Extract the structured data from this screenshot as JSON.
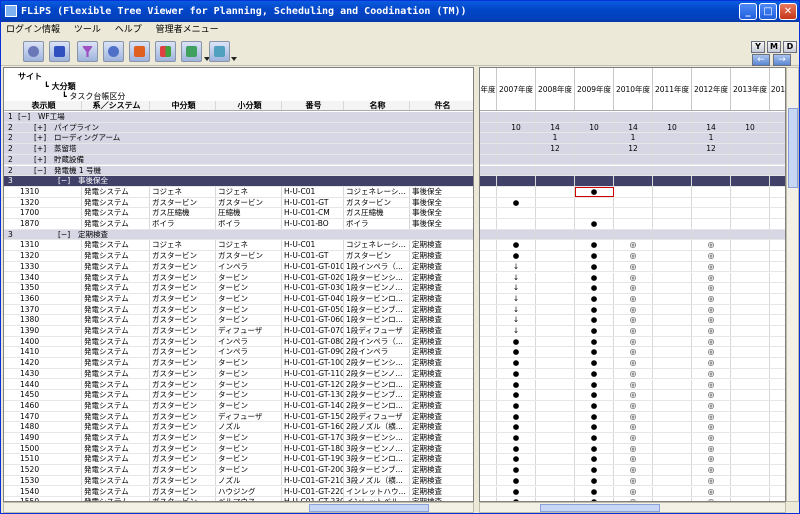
{
  "window": {
    "title": "FLiPS (Flexible Tree Viewer for Planning, Scheduling and Coodination (TM))"
  },
  "menu": [
    "ログイン情報",
    "ツール",
    "ヘルプ",
    "管理者メニュー"
  ],
  "toolbar_icons": [
    "binoculars-icon",
    "grid-blue-icon",
    "filter-icon",
    "search-icon",
    "grid-dots-icon",
    "color-grid-icon",
    "export-icon",
    "settings-icon"
  ],
  "right_buttons": {
    "y": "Y",
    "m": "M",
    "d": "D"
  },
  "tree_header": {
    "site": "サイト",
    "category_large": "大分類",
    "task_ledger": "タスク台帳区分",
    "columns": [
      "表示順",
      "系／システム",
      "中分類",
      "小分類",
      "番号",
      "名称",
      "件名"
    ]
  },
  "years": [
    "年度",
    "2007年度",
    "2008年度",
    "2009年度",
    "2010年度",
    "2011年度",
    "2012年度",
    "2013年度",
    "201"
  ],
  "tree_rows": [
    {
      "type": "g",
      "c": [
        "1",
        "[−]",
        "WF工場"
      ]
    },
    {
      "type": "g",
      "c": [
        "2",
        "[+]",
        "パイプライン"
      ]
    },
    {
      "type": "g",
      "c": [
        "2",
        "[+]",
        "ローディングアーム"
      ]
    },
    {
      "type": "g",
      "c": [
        "2",
        "[+]",
        "蒸留塔"
      ]
    },
    {
      "type": "g",
      "c": [
        "2",
        "[+]",
        "貯蔵設備"
      ]
    },
    {
      "type": "g",
      "c": [
        "2",
        "[−]",
        "発電機 1 号機"
      ]
    },
    {
      "type": "d",
      "c": [
        "3",
        "[−]",
        "事後保全"
      ]
    },
    {
      "type": "r",
      "c": [
        "1310",
        "発電システム",
        "コジェネ",
        "コジェネ",
        "H-U-C01",
        "コジェネレーシ...",
        "事後保全"
      ]
    },
    {
      "type": "r",
      "c": [
        "1320",
        "発電システム",
        "ガスタービン",
        "ガスタービン",
        "H-U-C01-GT",
        "ガスタービン",
        "事後保全"
      ]
    },
    {
      "type": "r",
      "c": [
        "1700",
        "発電システム",
        "ガス圧縮機",
        "圧縮機",
        "H-U-C01-CM",
        "ガス圧縮機",
        "事後保全"
      ]
    },
    {
      "type": "r",
      "c": [
        "1870",
        "発電システム",
        "ボイラ",
        "ボイラ",
        "H-U-C01-BO",
        "ボイラ",
        "事後保全"
      ]
    },
    {
      "type": "s",
      "c": [
        "3",
        "[−]",
        "定期検査"
      ]
    },
    {
      "type": "r",
      "c": [
        "1310",
        "発電システム",
        "コジェネ",
        "コジェネ",
        "H-U-C01",
        "コジェネレーシ...",
        "定期検査"
      ]
    },
    {
      "type": "r",
      "c": [
        "1320",
        "発電システム",
        "ガスタービン",
        "ガスタービン",
        "H-U-C01-GT",
        "ガスタービン",
        "定期検査"
      ]
    },
    {
      "type": "r",
      "c": [
        "1330",
        "発電システム",
        "ガスタービン",
        "インペラ",
        "H-U-C01-GT-010",
        "1段インペラ（...",
        "定期検査"
      ]
    },
    {
      "type": "r",
      "c": [
        "1340",
        "発電システム",
        "ガスタービン",
        "タービン",
        "H-U-C01-GT-020",
        "1段タービンシ...",
        "定期検査"
      ]
    },
    {
      "type": "r",
      "c": [
        "1350",
        "発電システム",
        "ガスタービン",
        "タービン",
        "H-U-C01-GT-030",
        "1段タービンノ...",
        "定期検査"
      ]
    },
    {
      "type": "r",
      "c": [
        "1360",
        "発電システム",
        "ガスタービン",
        "タービン",
        "H-U-C01-GT-040",
        "1段タービンロ...",
        "定期検査"
      ]
    },
    {
      "type": "r",
      "c": [
        "1370",
        "発電システム",
        "ガスタービン",
        "タービン",
        "H-U-C01-GT-050",
        "1段タービンブ...",
        "定期検査"
      ]
    },
    {
      "type": "r",
      "c": [
        "1380",
        "発電システム",
        "ガスタービン",
        "タービン",
        "H-U-C01-GT-060",
        "1段タービンロ...",
        "定期検査"
      ]
    },
    {
      "type": "r",
      "c": [
        "1390",
        "発電システム",
        "ガスタービン",
        "ディフューザ",
        "H-U-C01-GT-070",
        "1段ディフューザ",
        "定期検査"
      ]
    },
    {
      "type": "r",
      "c": [
        "1400",
        "発電システム",
        "ガスタービン",
        "インペラ",
        "H-U-C01-GT-080",
        "2段インペラ（...",
        "定期検査"
      ]
    },
    {
      "type": "r",
      "c": [
        "1410",
        "発電システム",
        "ガスタービン",
        "インペラ",
        "H-U-C01-GT-090",
        "2段インペラ",
        "定期検査"
      ]
    },
    {
      "type": "r",
      "c": [
        "1420",
        "発電システム",
        "ガスタービン",
        "タービン",
        "H-U-C01-GT-100",
        "2段タービンシ...",
        "定期検査"
      ]
    },
    {
      "type": "r",
      "c": [
        "1430",
        "発電システム",
        "ガスタービン",
        "タービン",
        "H-U-C01-GT-110",
        "2段タービンノ...",
        "定期検査"
      ]
    },
    {
      "type": "r",
      "c": [
        "1440",
        "発電システム",
        "ガスタービン",
        "タービン",
        "H-U-C01-GT-120",
        "2段タービンロ...",
        "定期検査"
      ]
    },
    {
      "type": "r",
      "c": [
        "1450",
        "発電システム",
        "ガスタービン",
        "タービン",
        "H-U-C01-GT-130",
        "2段タービンブ...",
        "定期検査"
      ]
    },
    {
      "type": "r",
      "c": [
        "1460",
        "発電システム",
        "ガスタービン",
        "タービン",
        "H-U-C01-GT-140",
        "2段タービンロ...",
        "定期検査"
      ]
    },
    {
      "type": "r",
      "c": [
        "1470",
        "発電システム",
        "ガスタービン",
        "ディフューザ",
        "H-U-C01-GT-150",
        "2段ディフューザ",
        "定期検査"
      ]
    },
    {
      "type": "r",
      "c": [
        "1480",
        "発電システム",
        "ガスタービン",
        "ノズル",
        "H-U-C01-GT-160",
        "2段ノズル（横...",
        "定期検査"
      ]
    },
    {
      "type": "r",
      "c": [
        "1490",
        "発電システム",
        "ガスタービン",
        "タービン",
        "H-U-C01-GT-170",
        "3段タービンシ...",
        "定期検査"
      ]
    },
    {
      "type": "r",
      "c": [
        "1500",
        "発電システム",
        "ガスタービン",
        "タービン",
        "H-U-C01-GT-180",
        "3段タービンノ...",
        "定期検査"
      ]
    },
    {
      "type": "r",
      "c": [
        "1510",
        "発電システム",
        "ガスタービン",
        "タービン",
        "H-U-C01-GT-190",
        "3段タービンロ...",
        "定期検査"
      ]
    },
    {
      "type": "r",
      "c": [
        "1520",
        "発電システム",
        "ガスタービン",
        "タービン",
        "H-U-C01-GT-200",
        "3段タービンブ...",
        "定期検査"
      ]
    },
    {
      "type": "r",
      "c": [
        "1530",
        "発電システム",
        "ガスタービン",
        "ノズル",
        "H-U-C01-GT-210",
        "3段ノズル（横...",
        "定期検査"
      ]
    },
    {
      "type": "r",
      "c": [
        "1540",
        "発電システム",
        "ガスタービン",
        "ハウジング",
        "H-U-C01-GT-220",
        "インレットハウ...",
        "定期検査"
      ]
    },
    {
      "type": "r",
      "c": [
        "1550",
        "発電システム",
        "ガスタービン",
        "ベルマウス",
        "H-U-C01-GT-230",
        "インレットベル...",
        "定期検査"
      ]
    }
  ],
  "year_rows": [
    [
      "",
      "",
      "",
      "",
      "",
      "",
      "",
      "",
      ""
    ],
    [
      "",
      "10",
      "14",
      "10",
      "14",
      "10",
      "14",
      "10",
      ""
    ],
    [
      "",
      "",
      "1",
      "",
      "1",
      "",
      "1",
      "",
      ""
    ],
    [
      "",
      "",
      "12",
      "",
      "12",
      "",
      "12",
      "",
      ""
    ],
    [
      "",
      "",
      "",
      "",
      "",
      "",
      "",
      "",
      ""
    ],
    [
      "",
      "",
      "",
      "",
      "",
      "",
      "",
      "",
      ""
    ],
    [
      "",
      "",
      "",
      "",
      "",
      "",
      "",
      "",
      ""
    ],
    [
      "",
      "",
      "",
      "●",
      "",
      "",
      "",
      "",
      ""
    ],
    [
      "",
      "●",
      "",
      "",
      "",
      "",
      "",
      "",
      ""
    ],
    [
      "",
      "",
      "",
      "",
      "",
      "",
      "",
      "",
      ""
    ],
    [
      "",
      "",
      "",
      "●",
      "",
      "",
      "",
      "",
      ""
    ],
    [
      "",
      "",
      "",
      "",
      "",
      "",
      "",
      "",
      ""
    ],
    [
      "",
      "●",
      "",
      "●",
      "◎",
      "",
      "◎",
      "",
      ""
    ],
    [
      "",
      "●",
      "",
      "●",
      "◎",
      "",
      "◎",
      "",
      ""
    ],
    [
      "",
      "↓",
      "",
      "●",
      "◎",
      "",
      "◎",
      "",
      ""
    ],
    [
      "",
      "↓",
      "",
      "●",
      "◎",
      "",
      "◎",
      "",
      ""
    ],
    [
      "",
      "↓",
      "",
      "●",
      "◎",
      "",
      "◎",
      "",
      ""
    ],
    [
      "",
      "↓",
      "",
      "●",
      "◎",
      "",
      "◎",
      "",
      ""
    ],
    [
      "",
      "↓",
      "",
      "●",
      "◎",
      "",
      "◎",
      "",
      ""
    ],
    [
      "",
      "↓",
      "",
      "●",
      "◎",
      "",
      "◎",
      "",
      ""
    ],
    [
      "",
      "↓",
      "",
      "●",
      "◎",
      "",
      "◎",
      "",
      ""
    ],
    [
      "",
      "●",
      "",
      "●",
      "◎",
      "",
      "◎",
      "",
      ""
    ],
    [
      "",
      "●",
      "",
      "●",
      "◎",
      "",
      "◎",
      "",
      ""
    ],
    [
      "",
      "●",
      "",
      "●",
      "◎",
      "",
      "◎",
      "",
      ""
    ],
    [
      "",
      "●",
      "",
      "●",
      "◎",
      "",
      "◎",
      "",
      ""
    ],
    [
      "",
      "●",
      "",
      "●",
      "◎",
      "",
      "◎",
      "",
      ""
    ],
    [
      "",
      "●",
      "",
      "●",
      "◎",
      "",
      "◎",
      "",
      ""
    ],
    [
      "",
      "●",
      "",
      "●",
      "◎",
      "",
      "◎",
      "",
      ""
    ],
    [
      "",
      "●",
      "",
      "●",
      "◎",
      "",
      "◎",
      "",
      ""
    ],
    [
      "",
      "●",
      "",
      "●",
      "◎",
      "",
      "◎",
      "",
      ""
    ],
    [
      "",
      "●",
      "",
      "●",
      "◎",
      "",
      "◎",
      "",
      ""
    ],
    [
      "",
      "●",
      "",
      "●",
      "◎",
      "",
      "◎",
      "",
      ""
    ],
    [
      "",
      "●",
      "",
      "●",
      "◎",
      "",
      "◎",
      "",
      ""
    ],
    [
      "",
      "●",
      "",
      "●",
      "◎",
      "",
      "◎",
      "",
      ""
    ],
    [
      "",
      "●",
      "",
      "●",
      "◎",
      "",
      "◎",
      "",
      ""
    ],
    [
      "",
      "●",
      "",
      "●",
      "◎",
      "",
      "◎",
      "",
      ""
    ],
    [
      "",
      "●",
      "",
      "●",
      "◎",
      "",
      "◎",
      "",
      ""
    ]
  ],
  "selected_cell": {
    "row": 7,
    "col": 3
  }
}
